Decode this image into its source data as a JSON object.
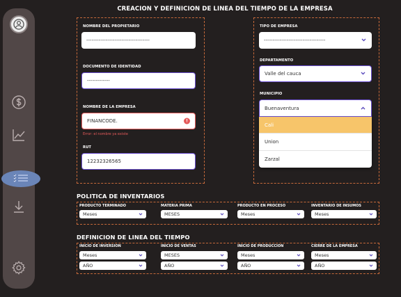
{
  "page": {
    "title": "CREACION  Y DEFINICION DE LINEA DEL TIEMPO DE LA EMPRESA"
  },
  "company_form": {
    "owner_label": "NOMBRE DEL PROPIETARIO",
    "owner_value": "------------------------------------",
    "id_label": "DOCUMENTO DE IDENTIDAD",
    "id_value": "-------------",
    "company_label": "NOMBRE DE LA EMPRESA",
    "company_value": "FINANCODE.",
    "company_error": "Error: el nombre ya existe",
    "rut_label": "RUT",
    "rut_value": "12232326565"
  },
  "type_form": {
    "type_label": "TIPO DE EMPRESA",
    "type_value": "-----------------------------------",
    "department_label": "DEPARTAMENTO",
    "department_value": "Valle del cauca",
    "municipality_label": "MUNICIPIO",
    "municipality_value": "Buenaventura",
    "municipality_options": [
      "Cali",
      "Union",
      "Zarzal"
    ],
    "highlighted_option": "Cali"
  },
  "inventory": {
    "title": "POLITICA DE INVENTARIOS",
    "fields": [
      {
        "label": "PRODUCTO TERMINADO",
        "value": "Meses"
      },
      {
        "label": "MATERIA PRIMA",
        "value": "MESES"
      },
      {
        "label": "PRODUCTO EN PROCESO",
        "value": "Meses"
      },
      {
        "label": "INVENTARIO DE INSUMOS",
        "value": "Meses"
      }
    ]
  },
  "timeline": {
    "title": "DEFINICION DE LINEA DEL TIEMPO",
    "fields": [
      {
        "label": "INICIO DE INVERSION",
        "unit": "Meses",
        "year": "AÑO"
      },
      {
        "label": "INICIO DE VENTAS",
        "unit": "MESES",
        "year": "AÑO"
      },
      {
        "label": "INICIO DE PRODUCCION",
        "unit": "Meses",
        "year": "AÑO"
      },
      {
        "label": "CIERRE DE LA EMPRESA",
        "unit": "Meses",
        "year": "AÑO"
      }
    ]
  },
  "sidebar": {
    "icons": [
      "user-avatar-icon",
      "dollar-icon",
      "chart-icon",
      "checklist-icon",
      "download-icon",
      "settings-icon"
    ]
  },
  "colors": {
    "background": "#231f1f",
    "sidebar": "#514747",
    "accent": "#6a4fd1",
    "error": "#e55a5a",
    "highlight": "#f7c56a",
    "dashed": "#c86a3a"
  }
}
